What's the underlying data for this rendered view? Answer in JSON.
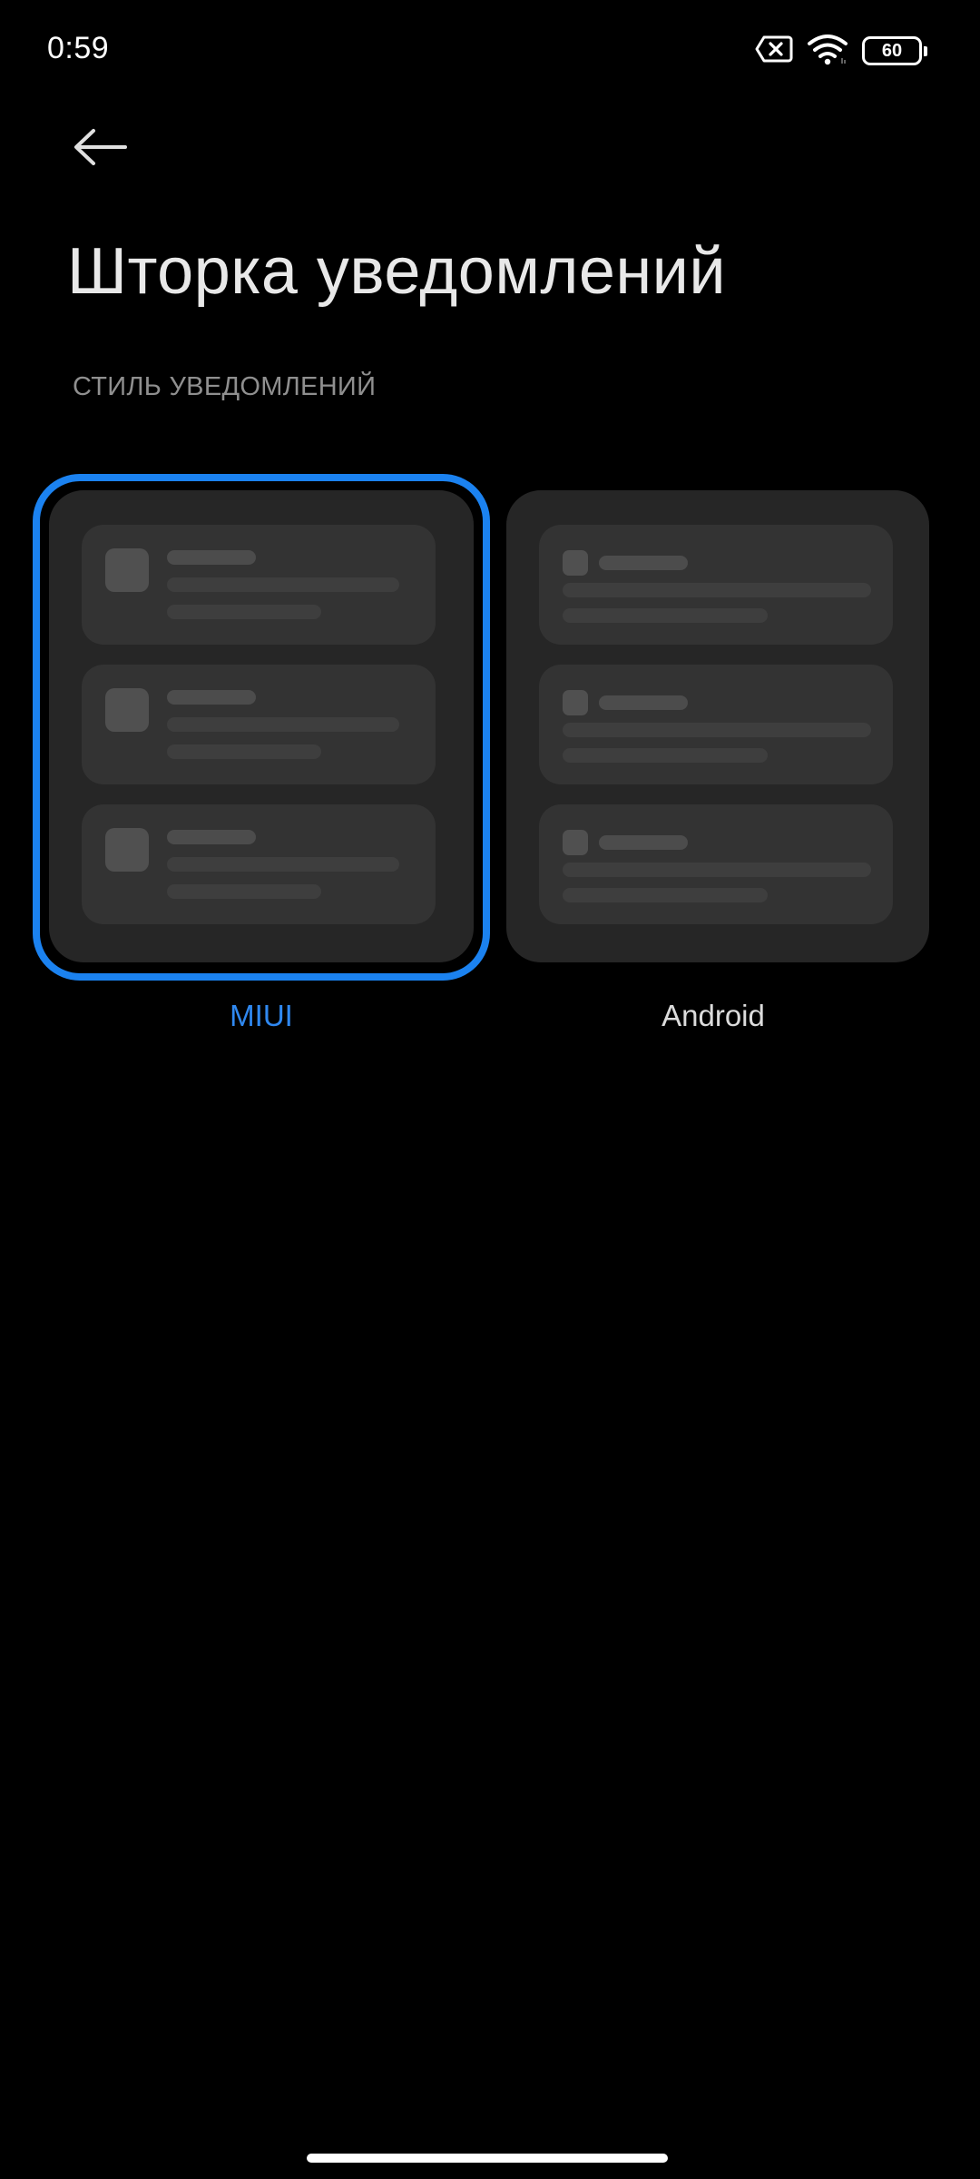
{
  "status_bar": {
    "time": "0:59",
    "battery_level": "60",
    "icons": [
      "no-sim-icon",
      "wifi-icon",
      "battery-icon"
    ]
  },
  "header": {
    "back_icon": "arrow-left-icon",
    "title": "Шторка уведомлений"
  },
  "section": {
    "header": "СТИЛЬ УВЕДОМЛЕНИЙ"
  },
  "styles": {
    "selected": "MIUI",
    "options": [
      {
        "label": "MIUI",
        "selected": true
      },
      {
        "label": "Android",
        "selected": false
      }
    ]
  },
  "colors": {
    "background": "#000000",
    "accent": "#1b82f0",
    "card": "#262626",
    "notification": "#333333"
  }
}
